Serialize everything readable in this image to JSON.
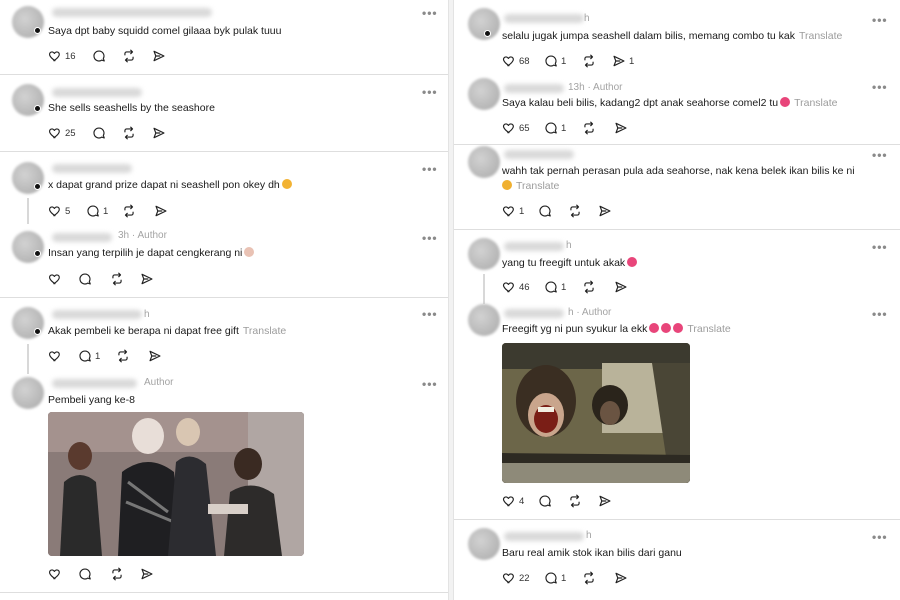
{
  "left": {
    "posts": [
      {
        "text": "Saya dpt baby squidd comel gilaaa byk pulak tuuu",
        "likes": "16",
        "replies": "",
        "translate": ""
      },
      {
        "text": "She sells seashells by the seashore",
        "likes": "25",
        "replies": "",
        "translate": ""
      },
      {
        "text": "x dapat grand prize dapat ni seashell pon okey dh",
        "likes": "5",
        "replies": "1",
        "translate": ""
      },
      {
        "time": "3h",
        "author_label": "Author",
        "text": "Insan yang terpilih je dapat cengkerang ni",
        "likes": "",
        "replies": "",
        "translate": ""
      },
      {
        "time": "h",
        "text": "Akak pembeli ke berapa ni dapat free gift",
        "likes": "",
        "replies": "1",
        "translate": "Translate"
      },
      {
        "author_label": "Author",
        "text": "Pembeli yang ke-8",
        "likes": "",
        "replies": "",
        "translate": ""
      }
    ]
  },
  "right": {
    "posts": [
      {
        "time": "h",
        "text": "selalu jugak jumpa seashell dalam bilis, memang combo tu kak",
        "likes": "68",
        "replies": "1",
        "shares": "1",
        "translate": "Translate"
      },
      {
        "time": "13h",
        "author_label": "Author",
        "text": "Saya kalau beli bilis, kadang2 dpt anak seahorse comel2 tu",
        "likes": "65",
        "replies": "1",
        "translate": "Translate"
      },
      {
        "text": "wahh tak pernah perasan pula ada seahorse, nak kena belek ikan bilis ke ni",
        "likes": "1",
        "replies": "",
        "translate": "Translate"
      },
      {
        "time": "h",
        "text": "yang tu freegift untuk akak",
        "likes": "46",
        "replies": "1",
        "translate": ""
      },
      {
        "time": "h",
        "author_label": "Author",
        "text": "Freegift yg ni pun syukur la ekk",
        "likes": "4",
        "replies": "",
        "translate": "Translate"
      },
      {
        "time": "h",
        "text": "Baru real amik stok ikan bilis dari ganu",
        "likes": "22",
        "replies": "1",
        "translate": ""
      }
    ]
  },
  "icons": {
    "like": "heart-icon",
    "reply": "comment-icon",
    "repost": "repost-icon",
    "share": "share-icon",
    "more": "more-icon"
  },
  "colors": {
    "text": "#1a1a1a",
    "muted": "#a3a3a3",
    "divider": "#dedede"
  }
}
